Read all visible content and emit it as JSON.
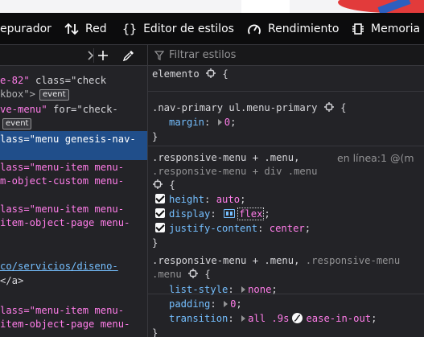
{
  "toolbar": {
    "tabs": [
      {
        "label": "epurador",
        "icon": "debugger-icon"
      },
      {
        "label": "Red",
        "icon": "network-arrows-icon"
      },
      {
        "label": "Editor de estilos",
        "icon": "braces-icon"
      },
      {
        "label": "Rendimiento",
        "icon": "gauge-icon"
      },
      {
        "label": "Memoria",
        "icon": "memory-chip-icon"
      }
    ]
  },
  "markup": {
    "lines": [
      {
        "attr": "e-82\"",
        "rest": " class=\"check"
      },
      {
        "plain": "kbox\">",
        "badge": "event"
      },
      {
        "attr": "ve-menu\"",
        "rest": " for=\"check-"
      },
      {
        "badge": "event"
      },
      {
        "attr": "lass=\"menu genesis-nav-"
      },
      {
        "attr": "lass=\"menu-item menu-"
      },
      {
        "attr": "m-object-custom menu-"
      },
      {
        "attr": "lass=\"menu-item menu-"
      },
      {
        "attr": "item-object-page menu-"
      },
      {
        "link": "co/servicios/diseno-"
      },
      {
        "tag": "</a>"
      },
      {
        "attr": "lass=\"menu-item menu-"
      },
      {
        "attr": "item-object-page menu-"
      }
    ],
    "badge_label": "event"
  },
  "rules": {
    "filter_placeholder": "Filtrar estilos",
    "element_selector": "elemento",
    "rule1": {
      "selector": ".nav-primary ul.menu-primary",
      "prop": "margin",
      "value": "0"
    },
    "rule2": {
      "selector_a": ".responsive-menu + .menu,",
      "selector_b": ".responsive-menu + div .menu",
      "source": "en línea:1 @(m",
      "decls": [
        {
          "prop": "height",
          "value": "auto"
        },
        {
          "prop": "display",
          "value": "flex"
        },
        {
          "prop": "justify-content",
          "value": "center"
        }
      ]
    },
    "rule3": {
      "selector_a": ".responsive-menu + .menu,",
      "selector_b": " .responsive-menu",
      "selector_c": ".menu",
      "decls": [
        {
          "prop": "list-style",
          "value": "none"
        },
        {
          "prop": "padding",
          "value": "0"
        },
        {
          "prop": "transition",
          "value_a": "all .9s",
          "value_b": "ease-in-out"
        }
      ]
    }
  }
}
